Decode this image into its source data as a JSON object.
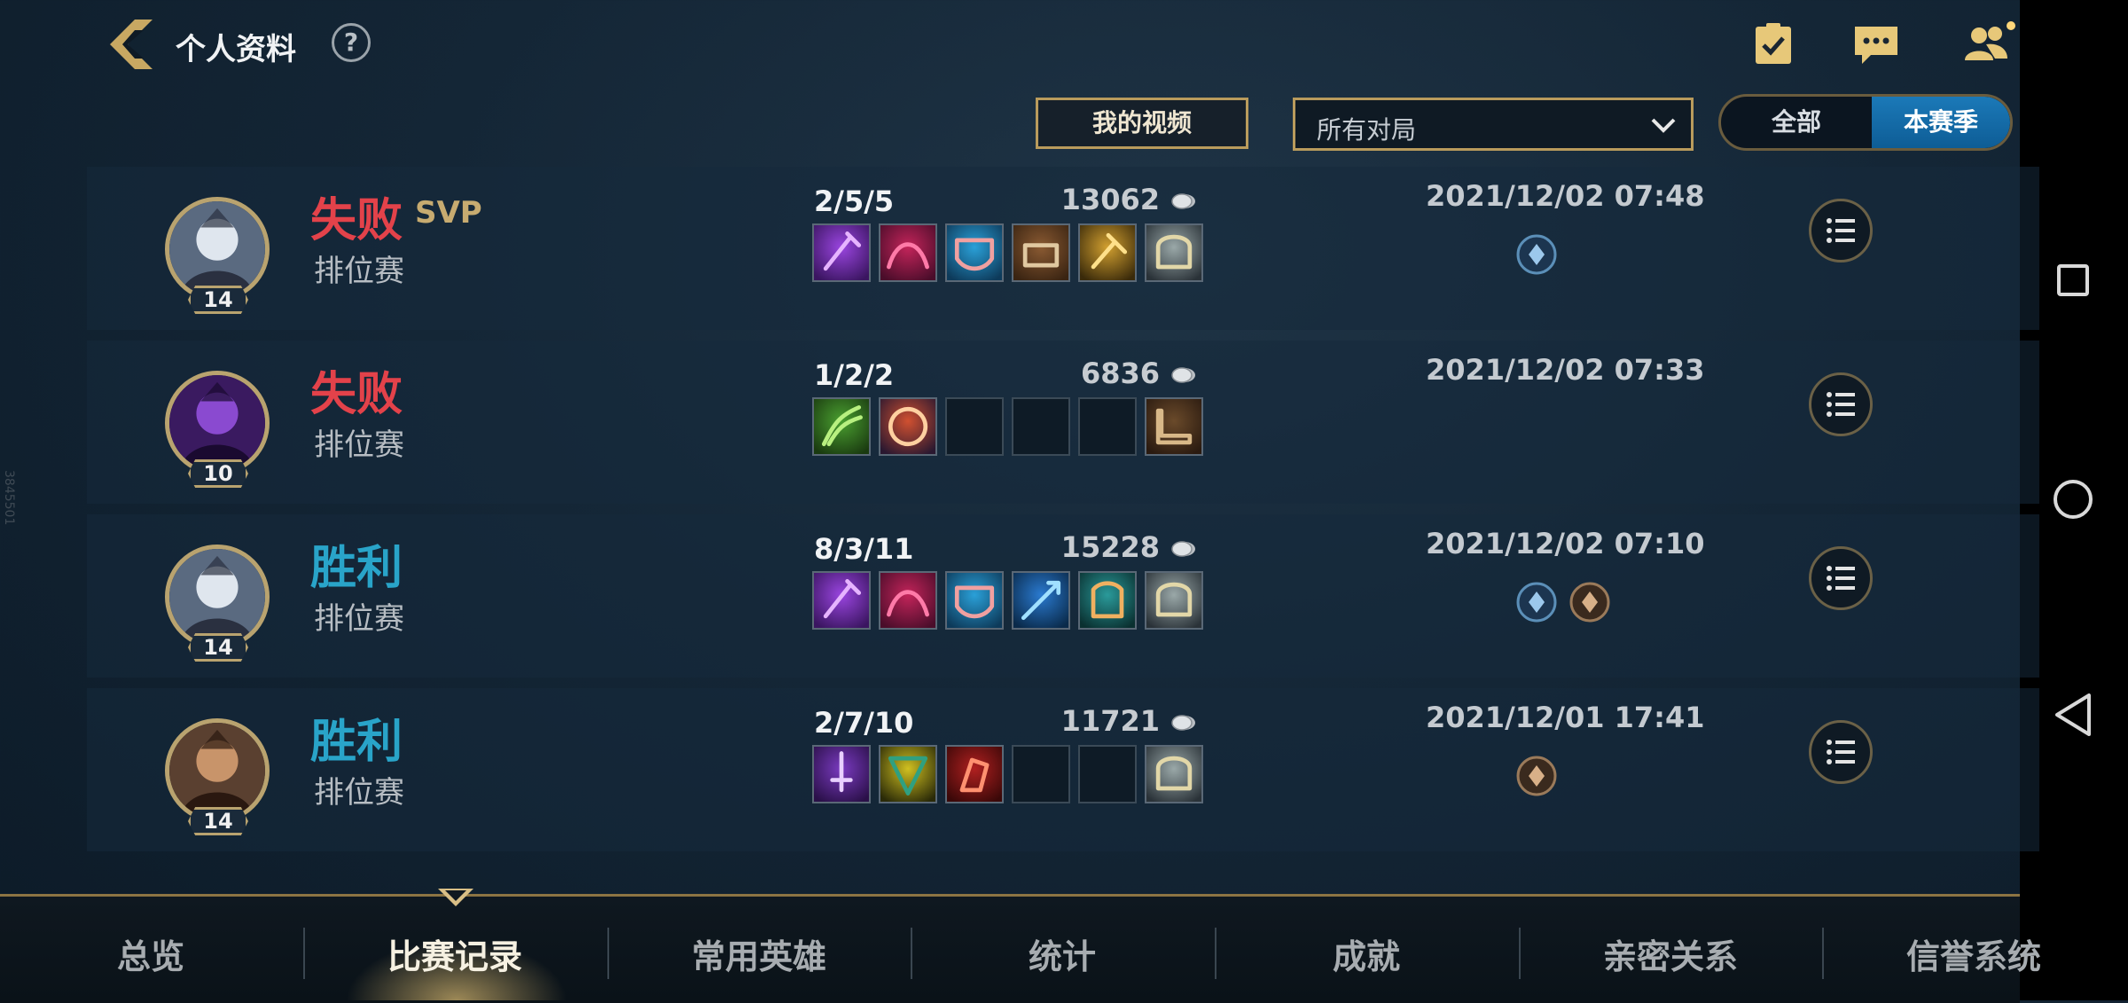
{
  "header": {
    "title": "个人资料",
    "help": "?",
    "icons": [
      "checklist-icon",
      "chat-icon",
      "friends-icon"
    ]
  },
  "filters": {
    "my_videos": "我的视频",
    "match_filter": "所有对局",
    "segment_all": "全部",
    "segment_season": "本赛季",
    "segment_selected": "本赛季"
  },
  "matches": [
    {
      "result": "失败",
      "result_type": "lose",
      "svp": "SVP",
      "mode": "排位赛",
      "level": "14",
      "kda": "2/5/5",
      "gold": "13062",
      "time": "2021/12/02 07:48",
      "items": [
        "purple-staff",
        "crimson-beast",
        "blue-mask",
        "brown-fist",
        "golden-hammer",
        "silver-helm"
      ],
      "runes": [
        "blue-rune"
      ]
    },
    {
      "result": "失败",
      "result_type": "lose",
      "svp": "",
      "mode": "排位赛",
      "level": "10",
      "kda": "1/2/2",
      "gold": "6836",
      "time": "2021/12/02 07:33",
      "items": [
        "green-claw",
        "target-orb",
        "",
        "",
        "",
        "brown-boots"
      ],
      "runes": []
    },
    {
      "result": "胜利",
      "result_type": "win",
      "svp": "",
      "mode": "排位赛",
      "level": "14",
      "kda": "8/3/11",
      "gold": "15228",
      "time": "2021/12/02 07:10",
      "items": [
        "purple-staff",
        "crimson-beast",
        "blue-mask",
        "blue-spear",
        "scale-armor",
        "silver-helm"
      ],
      "runes": [
        "blue-rune",
        "brown-rune"
      ]
    },
    {
      "result": "胜利",
      "result_type": "win",
      "svp": "",
      "mode": "排位赛",
      "level": "14",
      "kda": "2/7/10",
      "gold": "11721",
      "time": "2021/12/01 17:41",
      "items": [
        "purple-sword",
        "yellow-shield",
        "red-gauntlet",
        "",
        "",
        "silver-helm"
      ],
      "runes": [
        "brown-rune"
      ]
    }
  ],
  "tabs": [
    "总览",
    "比赛记录",
    "常用英雄",
    "统计",
    "成就",
    "亲密关系",
    "信誉系统"
  ],
  "active_tab": "比赛记录",
  "side_id": "3845501",
  "colors": {
    "lose": "#e3424a",
    "win": "#29a4c9",
    "gold_accent": "#b99b5c",
    "segment_active": "#1b79b8"
  }
}
